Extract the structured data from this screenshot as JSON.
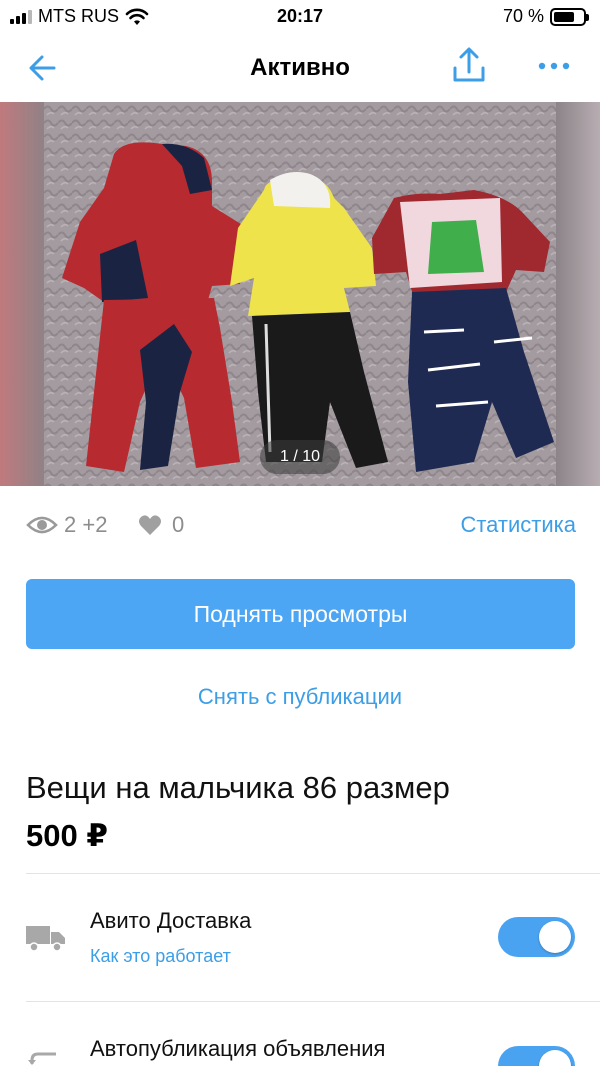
{
  "status_bar": {
    "carrier": "MTS RUS",
    "time": "20:17",
    "battery": "70 %"
  },
  "nav": {
    "title": "Активно"
  },
  "gallery": {
    "counter": "1 / 10"
  },
  "stats": {
    "views": "2 +2",
    "likes": "0",
    "statistics_link": "Статистика"
  },
  "actions": {
    "boost_label": "Поднять просмотры",
    "unpublish_label": "Снять с публикации"
  },
  "listing": {
    "title": "Вещи на мальчика 86 размер",
    "price": "500 ₽"
  },
  "options": [
    {
      "title": "Авито Доставка",
      "link": "Как это работает",
      "enabled": true
    },
    {
      "title": "Автопубликация объявления",
      "enabled": true
    }
  ],
  "colors": {
    "accent": "#4da6f4",
    "link": "#3c9ee6",
    "muted": "#8d8d8d"
  }
}
